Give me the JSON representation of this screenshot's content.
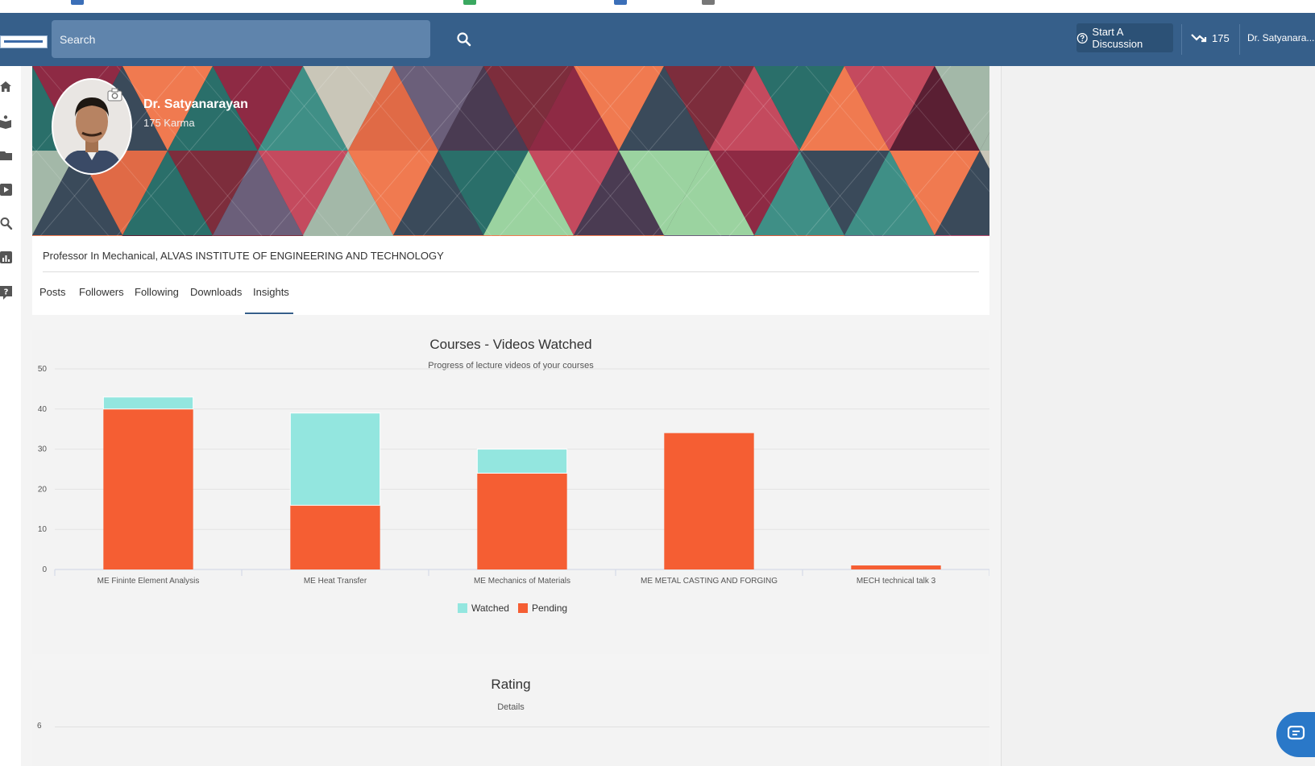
{
  "colors": {
    "header": "#365f8a",
    "accent": "#365f8a",
    "watched": "#93e6df",
    "pending": "#f55e33",
    "chat": "#2a78c8"
  },
  "header": {
    "search_placeholder": "Search",
    "start_discussion_label": "Start A Discussion",
    "karma_count": "175",
    "user_name": "Dr. Satyanara..."
  },
  "sidebar": {
    "icons": [
      "home-icon",
      "book-icon",
      "folder-icon",
      "video-icon",
      "search-icon",
      "chart-icon",
      "help-icon"
    ]
  },
  "profile": {
    "name": "Dr. Satyanarayan",
    "karma": "175 Karma",
    "bio": "Professor In Mechanical, ALVAS INSTITUTE OF ENGINEERING AND TECHNOLOGY",
    "tabs": [
      "Posts",
      "Followers",
      "Following",
      "Downloads",
      "Insights"
    ],
    "active_tab": "Insights"
  },
  "chart_data": [
    {
      "type": "bar",
      "stacked": true,
      "title": "Courses - Videos Watched",
      "subtitle": "Progress of lecture videos of your courses",
      "categories": [
        "ME Fininte Element Analysis",
        "ME Heat Transfer",
        "ME Mechanics of Materials",
        "ME METAL CASTING AND FORGING",
        "MECH technical talk 3"
      ],
      "series": [
        {
          "name": "Pending",
          "color": "#f55e33",
          "values": [
            40,
            16,
            24,
            34,
            1
          ]
        },
        {
          "name": "Watched",
          "color": "#93e6df",
          "values": [
            3,
            23,
            6,
            0,
            0
          ]
        }
      ],
      "legend": [
        "Watched",
        "Pending"
      ],
      "ylim": [
        0,
        50
      ],
      "yticks": [
        0,
        10,
        20,
        30,
        40,
        50
      ],
      "grid": true,
      "legend_position": "bottom-center"
    },
    {
      "type": "bar",
      "title": "Rating",
      "subtitle": "Details",
      "yticks_visible": [
        "6"
      ]
    }
  ]
}
